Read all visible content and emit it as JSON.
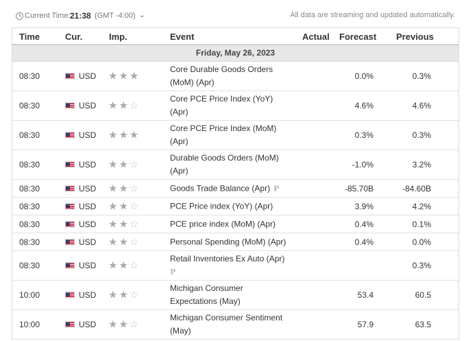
{
  "header": {
    "current_time_label": "Current Time:",
    "current_time": "21:38",
    "timezone": "(GMT -4:00)",
    "streaming_note": "All data are streaming and updated automatically."
  },
  "columns": {
    "time": "Time",
    "currency": "Cur.",
    "importance": "Imp.",
    "event": "Event",
    "actual": "Actual",
    "forecast": "Forecast",
    "previous": "Previous"
  },
  "date_label": "Friday, May 26, 2023",
  "rows": [
    {
      "time": "08:30",
      "currency": "USD",
      "stars": 3,
      "event_line1": "Core Durable Goods Orders",
      "event_line2": "(MoM) (Apr)",
      "prelim": "",
      "actual": "",
      "forecast": "0.0%",
      "previous": "0.3%"
    },
    {
      "time": "08:30",
      "currency": "USD",
      "stars": 2,
      "event_line1": "Core PCE Price Index (YoY)",
      "event_line2": "(Apr)",
      "prelim": "",
      "actual": "",
      "forecast": "4.6%",
      "previous": "4.6%"
    },
    {
      "time": "08:30",
      "currency": "USD",
      "stars": 3,
      "event_line1": "Core PCE Price Index (MoM)",
      "event_line2": "(Apr)",
      "prelim": "",
      "actual": "",
      "forecast": "0.3%",
      "previous": "0.3%"
    },
    {
      "time": "08:30",
      "currency": "USD",
      "stars": 2,
      "event_line1": "Durable Goods Orders (MoM)",
      "event_line2": "(Apr)",
      "prelim": "",
      "actual": "",
      "forecast": "-1.0%",
      "previous": "3.2%"
    },
    {
      "time": "08:30",
      "currency": "USD",
      "stars": 2,
      "event_line1": "Goods Trade Balance (Apr)",
      "event_line2": "",
      "prelim": "P",
      "actual": "",
      "forecast": "-85.70B",
      "previous": "-84.60B"
    },
    {
      "time": "08:30",
      "currency": "USD",
      "stars": 2,
      "event_line1": "PCE Price index (YoY) (Apr)",
      "event_line2": "",
      "prelim": "",
      "actual": "",
      "forecast": "3.9%",
      "previous": "4.2%"
    },
    {
      "time": "08:30",
      "currency": "USD",
      "stars": 2,
      "event_line1": "PCE price index (MoM) (Apr)",
      "event_line2": "",
      "prelim": "",
      "actual": "",
      "forecast": "0.4%",
      "previous": "0.1%"
    },
    {
      "time": "08:30",
      "currency": "USD",
      "stars": 2,
      "event_line1": "Personal Spending (MoM) (Apr)",
      "event_line2": "",
      "prelim": "",
      "actual": "",
      "forecast": "0.4%",
      "previous": "0.0%"
    },
    {
      "time": "08:30",
      "currency": "USD",
      "stars": 2,
      "event_line1": "Retail Inventories Ex Auto (Apr)",
      "event_line2": "",
      "prelim": "P",
      "prelim_newline": true,
      "actual": "",
      "forecast": "",
      "previous": "0.3%"
    },
    {
      "time": "10:00",
      "currency": "USD",
      "stars": 2,
      "event_line1": "Michigan Consumer",
      "event_line2": "Expectations (May)",
      "prelim": "",
      "actual": "",
      "forecast": "53.4",
      "previous": "60.5"
    },
    {
      "time": "10:00",
      "currency": "USD",
      "stars": 2,
      "event_line1": "Michigan Consumer Sentiment",
      "event_line2": "(May)",
      "prelim": "",
      "actual": "",
      "forecast": "57.9",
      "previous": "63.5"
    }
  ],
  "row_heights": [
    43,
    43,
    43,
    43,
    26,
    26,
    26,
    26,
    43,
    43,
    43
  ]
}
